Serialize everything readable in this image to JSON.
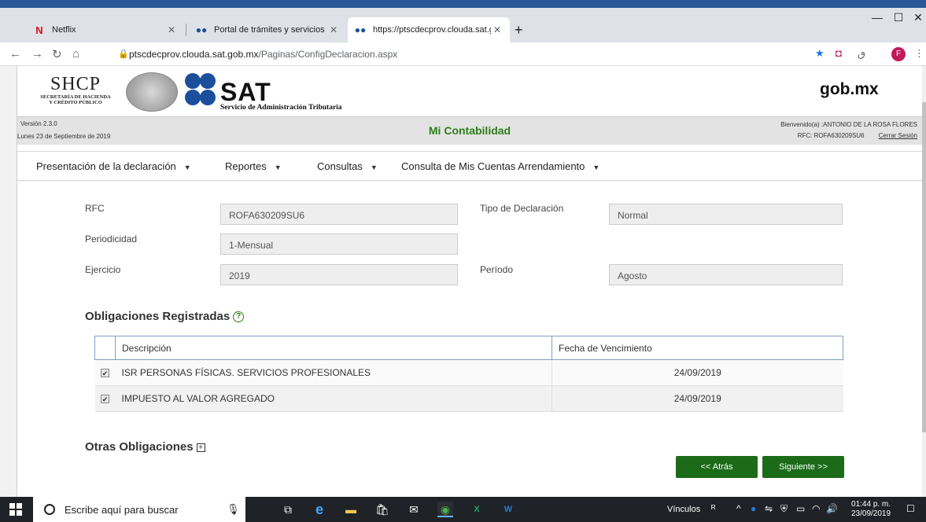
{
  "browser": {
    "tabs": [
      {
        "label": "Netflix",
        "favicon": "netflix-icon"
      },
      {
        "label": "Portal de trámites y servicios - SA",
        "favicon": "sat-icon"
      },
      {
        "label": "https://ptscdecprov.clouda.sat.go",
        "favicon": "sat-icon"
      }
    ],
    "url_host": "ptscdecprov.clouda.sat.gob.mx",
    "url_path": "/Paginas/ConfigDeclaracion.aspx",
    "profile_initial": "F"
  },
  "header": {
    "shcp_big": "SHCP",
    "shcp_line1": "SECRETARÍA DE HACIENDA",
    "shcp_line2": "Y CRÉDITO PÚBLICO",
    "sat_logo": "SAT",
    "sat_sub": "Servicio de Administración Tributaria",
    "gob": "gob.mx"
  },
  "info": {
    "version": "Versión 2.3.0",
    "fecha": "Lunes 23 de Septiembre de 2019",
    "title": "Mi Contabilidad",
    "bienvenido": "Bienvenido(a) :ANTONIO DE LA ROSA FLORES",
    "rfc": "RFC: ROFA630209SU6",
    "logout": "Cerrar Sesión"
  },
  "menu": [
    "Presentación de la declaración",
    "Reportes",
    "Consultas",
    "Consulta de Mis Cuentas Arrendamiento"
  ],
  "form": {
    "rfc_label": "RFC",
    "rfc_value": "ROFA630209SU6",
    "tipo_label": "Tipo de Declaración",
    "tipo_value": "Normal",
    "periodicidad_label": "Periodicidad",
    "periodicidad_value": "1-Mensual",
    "ejercicio_label": "Ejercicio",
    "ejercicio_value": "2019",
    "periodo_label": "Período",
    "periodo_value": "Agosto"
  },
  "obligaciones": {
    "title": "Obligaciones Registradas",
    "col_desc": "Descripción",
    "col_fecha": "Fecha de Vencimiento",
    "rows": [
      {
        "desc": "ISR PERSONAS FÍSICAS. SERVICIOS PROFESIONALES",
        "fecha": "24/09/2019",
        "checked": true
      },
      {
        "desc": "IMPUESTO AL VALOR AGREGADO",
        "fecha": "24/09/2019",
        "checked": true
      }
    ]
  },
  "otras": {
    "title": "Otras Obligaciones"
  },
  "buttons": {
    "back": "<< Atrás",
    "next": "Siguiente >>"
  },
  "taskbar": {
    "search_placeholder": "Escribe aquí para buscar",
    "vinculos": "Vínculos",
    "time": "01:44 p. m.",
    "date": "23/09/2019"
  },
  "colors": {
    "accent_green": "#1b6b18",
    "title_green": "#2e7d1a",
    "sat_blue": "#1b4f9c"
  }
}
